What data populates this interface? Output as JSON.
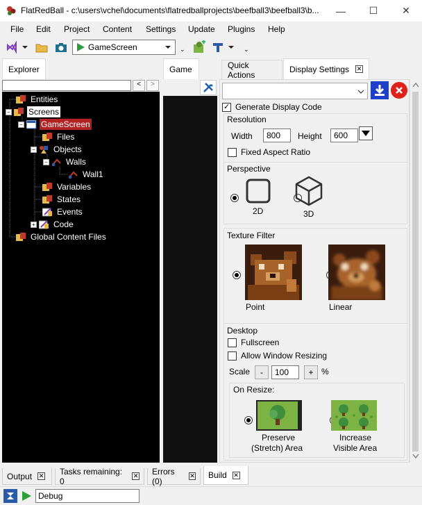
{
  "window": {
    "title": "FlatRedBall - c:\\users\\vchel\\documents\\flatredballprojects\\beefball3\\beefball3\\b...",
    "minimize": "—",
    "maximize": "☐",
    "close": "✕"
  },
  "menu": [
    "File",
    "Edit",
    "Project",
    "Content",
    "Settings",
    "Update",
    "Plugins",
    "Help"
  ],
  "toolbar": {
    "screen_selector": "GameScreen"
  },
  "tabs": {
    "explorer": "Explorer",
    "game": "Game",
    "quick_actions": "Quick Actions",
    "display_settings": "Display Settings"
  },
  "tree": [
    {
      "label": "Entities"
    },
    {
      "label": "Screens"
    },
    {
      "label": "GameScreen"
    },
    {
      "label": "Files"
    },
    {
      "label": "Objects"
    },
    {
      "label": "Walls"
    },
    {
      "label": "Wall1"
    },
    {
      "label": "Variables"
    },
    {
      "label": "States"
    },
    {
      "label": "Events"
    },
    {
      "label": "Code"
    },
    {
      "label": "Global Content Files"
    }
  ],
  "explorer_nav": {
    "back": "<",
    "forward": ">"
  },
  "display": {
    "generate_code": "Generate Display Code",
    "resolution": {
      "title": "Resolution",
      "width_label": "Width",
      "width": "800",
      "height_label": "Height",
      "height": "600",
      "fixed_aspect": "Fixed Aspect Ratio"
    },
    "perspective": {
      "title": "Perspective",
      "option_2d": "2D",
      "option_3d": "3D",
      "selected": "2D"
    },
    "texture_filter": {
      "title": "Texture Filter",
      "point": "Point",
      "linear": "Linear",
      "selected": "Point"
    },
    "desktop": {
      "title": "Desktop",
      "fullscreen": "Fullscreen",
      "allow_resize": "Allow Window Resizing",
      "scale_label": "Scale",
      "scale_minus": "-",
      "scale_value": "100",
      "scale_plus": "+",
      "scale_unit": "%"
    },
    "on_resize": {
      "title": "On Resize:",
      "preserve_line1": "Preserve",
      "preserve_line2": "(Stretch) Area",
      "increase_line1": "Increase",
      "increase_line2": "Visible Area",
      "selected": "Preserve"
    }
  },
  "bottom_tabs": [
    "Output",
    "Tasks remaining: 0",
    "Errors (0)",
    "Build"
  ],
  "statusbar": {
    "config": "Debug"
  },
  "colors": {
    "tree_bg": "#000000",
    "selection_red": "#b22222",
    "accent_blue": "#1e40c8",
    "close_red": "#e0201a"
  }
}
